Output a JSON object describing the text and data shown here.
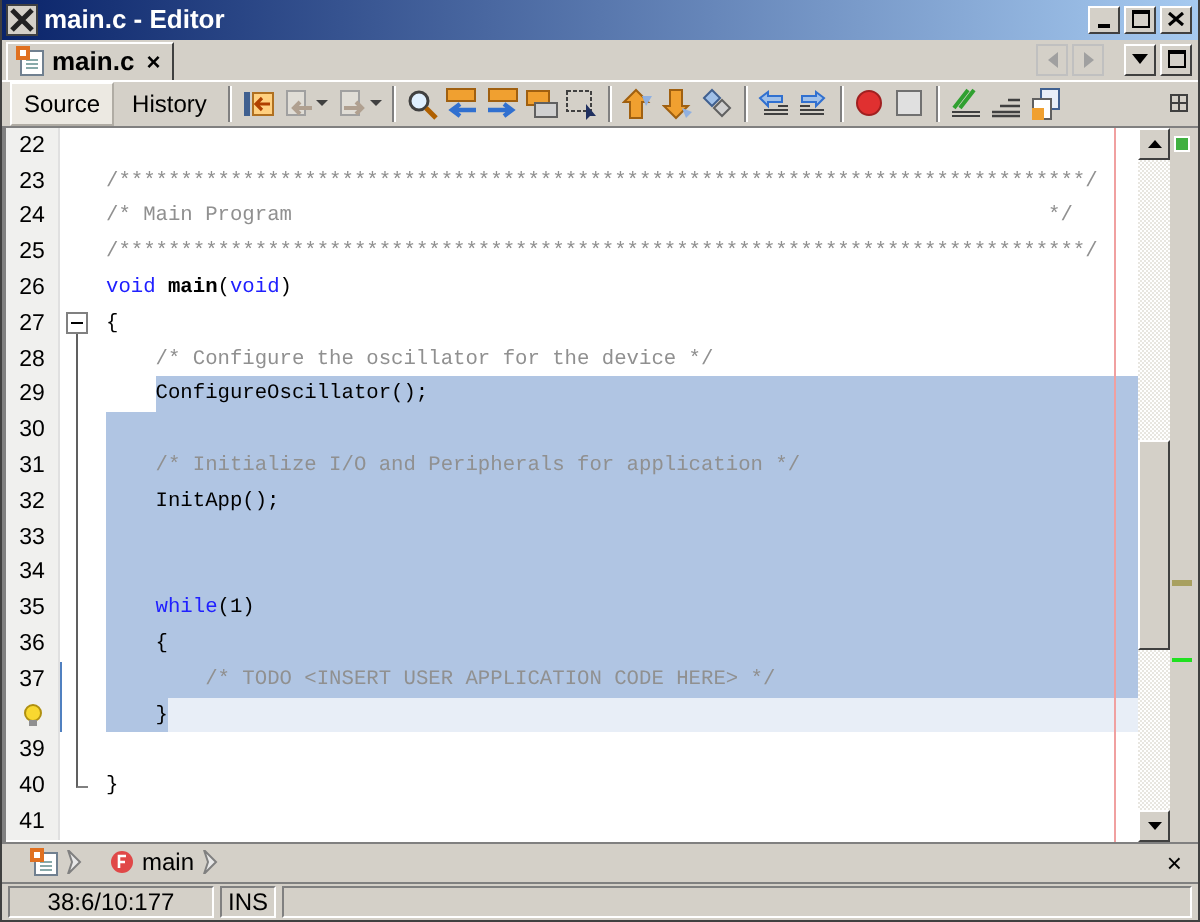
{
  "window": {
    "title": "main.c - Editor"
  },
  "tabs": [
    {
      "label": "main.c",
      "selected": true,
      "close": "×"
    }
  ],
  "view_tabs": [
    {
      "label": "Source",
      "selected": true
    },
    {
      "label": "History",
      "selected": false
    }
  ],
  "editor": {
    "lines": [
      {
        "number": "22",
        "selected": false,
        "current": false,
        "changed": false,
        "hint": false
      },
      {
        "number": "23",
        "selected": false,
        "current": false,
        "changed": false,
        "hint": false,
        "tokens": [
          {
            "kind": "comment",
            "text": "/******************************************************************************/"
          }
        ]
      },
      {
        "number": "24",
        "selected": false,
        "current": false,
        "changed": false,
        "hint": false,
        "tokens": [
          {
            "kind": "comment",
            "text": "/* Main Program                                                             */"
          }
        ]
      },
      {
        "number": "25",
        "selected": false,
        "current": false,
        "changed": false,
        "hint": false,
        "tokens": [
          {
            "kind": "comment",
            "text": "/******************************************************************************/"
          }
        ]
      },
      {
        "number": "26",
        "selected": false,
        "current": false,
        "changed": false,
        "hint": false,
        "tokens": [
          {
            "kind": "keyword",
            "text": "void"
          },
          {
            "kind": "function",
            "text": "main"
          },
          {
            "kind": "plain",
            "text": "("
          },
          {
            "kind": "keyword",
            "text": "void"
          },
          {
            "kind": "plain",
            "text": ")"
          }
        ]
      },
      {
        "number": "27",
        "selected": false,
        "current": false,
        "changed": false,
        "hint": false,
        "expanded": true,
        "tokens": [
          {
            "kind": "plain",
            "text": "{"
          }
        ],
        "children": [
          {
            "number": "28",
            "selected": false,
            "current": false,
            "changed": false,
            "hint": false,
            "tokens": [
              {
                "kind": "comment",
                "text": "/* Configure the oscillator for the device */"
              }
            ]
          },
          {
            "number": "29",
            "selected": true,
            "current": false,
            "changed": false,
            "hint": false,
            "tokens": [
              {
                "kind": "plain",
                "text": "ConfigureOscillator();"
              }
            ]
          },
          {
            "number": "30",
            "selected": true,
            "current": false,
            "changed": false,
            "hint": false
          },
          {
            "number": "31",
            "selected": true,
            "current": false,
            "changed": false,
            "hint": false,
            "tokens": [
              {
                "kind": "comment",
                "text": "/* Initialize I/O and Peripherals for application */"
              }
            ]
          },
          {
            "number": "32",
            "selected": true,
            "current": false,
            "changed": false,
            "hint": false,
            "tokens": [
              {
                "kind": "plain",
                "text": "InitApp();"
              }
            ]
          },
          {
            "number": "33",
            "selected": true,
            "current": false,
            "changed": false,
            "hint": false
          },
          {
            "number": "34",
            "selected": true,
            "current": false,
            "changed": false,
            "hint": false
          },
          {
            "number": "35",
            "selected": true,
            "current": false,
            "changed": false,
            "hint": false,
            "tokens": [
              {
                "kind": "keyword",
                "text": "while"
              },
              {
                "kind": "plain",
                "text": "(1)"
              }
            ]
          },
          {
            "number": "36",
            "selected": true,
            "current": false,
            "changed": false,
            "hint": false,
            "tokens": [
              {
                "kind": "plain",
                "text": "{"
              }
            ],
            "children": [
              {
                "number": "37",
                "selected": true,
                "current": false,
                "changed": true,
                "hint": false,
                "tokens": [
                  {
                    "kind": "comment",
                    "text": "/* TODO <INSERT USER APPLICATION CODE HERE> */"
                  }
                ]
              }
            ]
          },
          {
            "selected": true,
            "current": true,
            "changed": true,
            "hint": true,
            "tokens": [
              {
                "kind": "plain",
                "text": "}"
              }
            ]
          },
          {
            "number": "39",
            "selected": false,
            "current": false,
            "changed": false,
            "hint": false
          }
        ]
      },
      {
        "number": "40",
        "selected": false,
        "current": false,
        "changed": false,
        "hint": false,
        "tokens": [
          {
            "kind": "plain",
            "text": "}"
          }
        ]
      },
      {
        "number": "41",
        "selected": false,
        "current": false,
        "changed": false,
        "hint": false
      }
    ]
  },
  "breadcrumb": {
    "items": [
      {
        "kind": "function",
        "label": "main"
      }
    ],
    "close": "×"
  },
  "status_bar": {
    "position": "38:6/10:177",
    "mode": "INS"
  }
}
